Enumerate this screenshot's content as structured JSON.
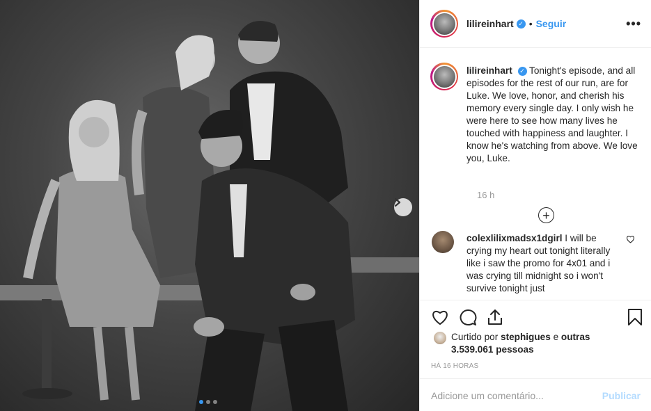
{
  "post": {
    "image_alt": "",
    "carousel": {
      "count": 3,
      "active": 0
    }
  },
  "header": {
    "username": "lilireinhart",
    "separator": "•",
    "follow_label": "Seguir",
    "more_icon": "more-horizontal-icon"
  },
  "caption": {
    "username": "lilireinhart",
    "text": "Tonight's episode, and all episodes for the rest of our run, are for Luke. We love, honor, and cherish his memory every single day. I only wish he were here to see how many lives he touched with happiness and laughter. I know he's watching from above. We love you, Luke.",
    "time_ago": "16 h"
  },
  "comments": [
    {
      "username": "colexlilixmadsx1dgirl",
      "text": "I will be crying my heart out tonight literally like i saw the promo for 4x01 and i was crying till midnight so i won't survive tonight just"
    }
  ],
  "actions": {
    "icons": [
      "heart-icon",
      "comment-icon",
      "share-icon",
      "bookmark-icon"
    ]
  },
  "likes": {
    "prefix": "Curtido por",
    "user": "stephigues",
    "connector": "e",
    "others": "outras 3.539.061 pessoas"
  },
  "timestamp": "HÁ 16 HORAS",
  "add_comment": {
    "placeholder": "Adicione um comentário...",
    "publish_label": "Publicar"
  },
  "colors": {
    "accent": "#3897f0",
    "publish_disabled": "#b3dbff",
    "muted": "#999999",
    "text": "#262626",
    "border": "#efefef"
  }
}
